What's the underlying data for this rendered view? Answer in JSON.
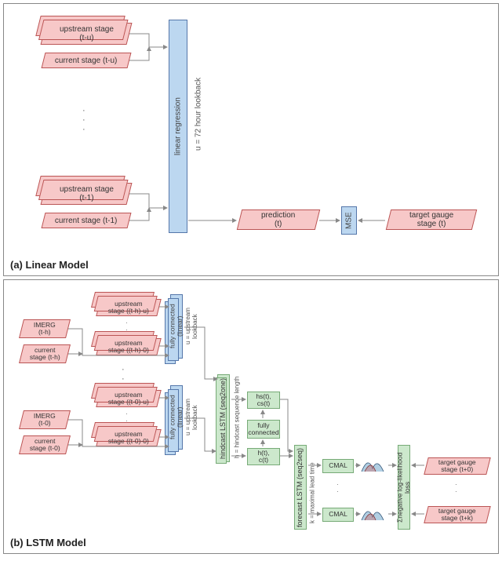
{
  "panelA": {
    "caption": "(a) Linear Model",
    "upstream_tu": "upstream stage\n(t-u)",
    "current_tu": "current stage (t-u)",
    "upstream_t1": "upstream stage\n(t-1)",
    "current_t1": "current stage (t-1)",
    "linreg": "linear regression",
    "lookback": "u = 72 hour lookback",
    "prediction": "prediction\n(t)",
    "mse": "MSE",
    "target": "target gauge\nstage (t)"
  },
  "panelB": {
    "caption": "(b) LSTM Model",
    "imerg_th": "IMERG\n(t-h)",
    "current_th": "current\nstage (t-h)",
    "upstream_th_u": "upstream\nstage ((t-h)-u)",
    "upstream_th_0": "upstream\nstage ((t-h)-0)",
    "imerg_t0": "IMERG\n(t-0)",
    "current_t0": "current\nstage (t-0)",
    "upstream_t0_u": "upstream\nstage ((t-0)-u)",
    "upstream_t0_0": "upstream\nstage ((t-0)-0)",
    "fc_label": "fully connected\n(linear)",
    "fc_sub": "u = upstream\nlookback",
    "hindcast": "hindcast LSTM (seq2one)",
    "hindcast_sub": "h = hindcast sequence length",
    "fully_connected_small": "fully\nconnected",
    "state1": "hs(t),\ncs(t)",
    "state2": "h(t),\nc(t)",
    "forecast": "forecast LSTM (seq2seq)",
    "forecast_sub": "k = maximal lead time",
    "cmal": "CMAL",
    "loss": "Σnegative log-likelihood loss",
    "target_t0": "target gauge\nstage (t+0)",
    "target_tk": "target gauge\nstage (t+k)"
  }
}
